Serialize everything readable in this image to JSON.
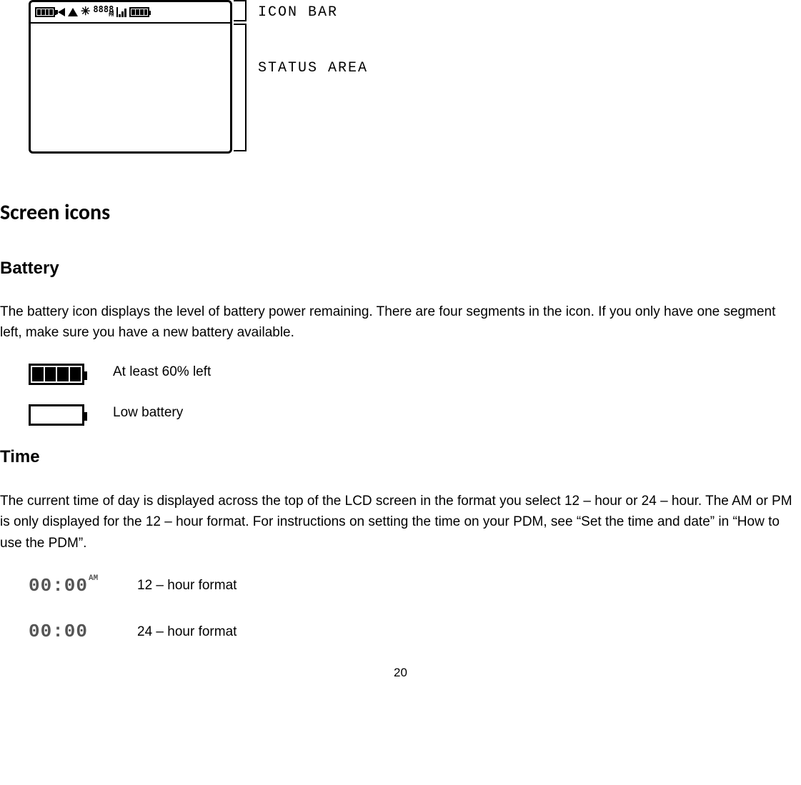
{
  "diagram": {
    "iconbar_label": "ICON BAR",
    "status_label": "STATUS AREA",
    "clock_digits": "8888",
    "clock_am": "AM",
    "clock_pm": "PM"
  },
  "headings": {
    "screen_icons": "Screen icons",
    "battery": "Battery",
    "time": "Time"
  },
  "battery": {
    "intro": "The battery icon displays the level of battery power remaining. There are four segments in the icon. If you only have one segment left, make sure you have a new battery available.",
    "full_label": "At least 60% left",
    "low_label": "Low battery"
  },
  "time": {
    "intro": "The current time of day is displayed across the top of the LCD screen in the format you select 12 – hour or 24 – hour. The AM or PM is only displayed for the 12 – hour format. For instructions on setting the time on your PDM, see “Set the time and date” in “How to use the PDM”.",
    "twelve_display": "00:00",
    "twelve_ampm": "AM",
    "twelve_label": "12 – hour format",
    "twentyfour_display": "00:00",
    "twentyfour_label": "24 – hour format"
  },
  "page_number": "20"
}
